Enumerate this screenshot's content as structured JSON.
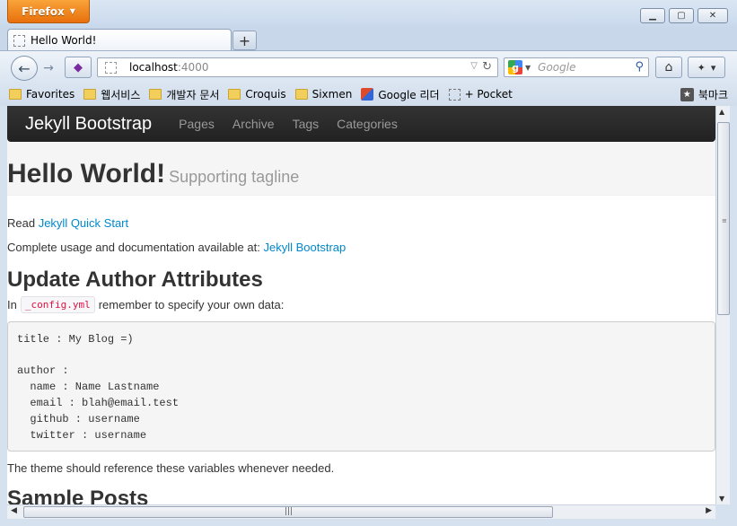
{
  "browser": {
    "menu_label": "Firefox",
    "tab_title": "Hello World!",
    "new_tab_symbol": "+",
    "url_host": "localhost",
    "url_port": ":4000",
    "search_placeholder": "Google",
    "search_logo": "g",
    "bookmarks": [
      {
        "label": "Favorites",
        "icon": "folder-icon"
      },
      {
        "label": "웹서비스",
        "icon": "folder-icon"
      },
      {
        "label": "개발자 문서",
        "icon": "folder-icon"
      },
      {
        "label": "Croquis",
        "icon": "folder-icon"
      },
      {
        "label": "Sixmen",
        "icon": "folder-icon"
      },
      {
        "label": "Google 리더",
        "icon": "google-reader-icon"
      },
      {
        "label": "+ Pocket",
        "icon": "pocket-icon"
      }
    ],
    "bookmarks_menu": "북마크"
  },
  "site": {
    "brand": "Jekyll Bootstrap",
    "nav": [
      "Pages",
      "Archive",
      "Tags",
      "Categories"
    ]
  },
  "content": {
    "title": "Hello World!",
    "tagline": "Supporting tagline",
    "read_prefix": "Read ",
    "quick_start_link": "Jekyll Quick Start",
    "docs_text": "Complete usage and documentation available at: ",
    "docs_link": "Jekyll Bootstrap",
    "update_heading": "Update Author Attributes",
    "in_text": "In",
    "config_file": "_config.yml",
    "remember_text": "remember to specify your own data:",
    "code_lines": [
      "title : My Blog =)",
      "",
      "author :",
      "  name : Name Lastname",
      "  email : blah@email.test",
      "  github : username",
      "  twitter : username"
    ],
    "theme_text": "The theme should reference these variables whenever needed.",
    "sample_heading": "Sample Posts"
  }
}
